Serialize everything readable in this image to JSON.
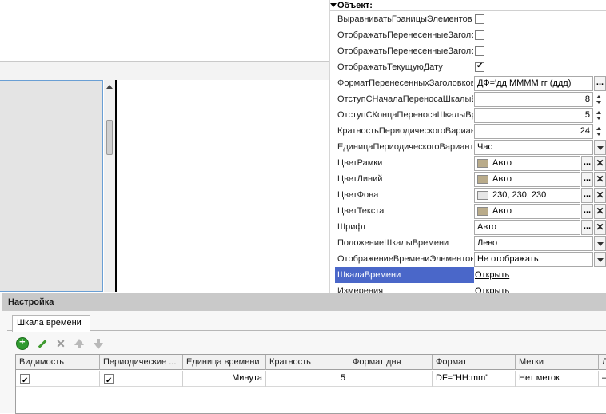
{
  "properties": {
    "section_title": "Объект:",
    "rows": [
      {
        "name": "ВыравниватьГраницыЭлементов",
        "type": "checkbox",
        "checked": false
      },
      {
        "name": "ОтображатьПеренесенныеЗаголовки",
        "type": "checkbox",
        "checked": false
      },
      {
        "name": "ОтображатьПеренесенныеЗаголовкиШкалы",
        "type": "checkbox",
        "checked": false
      },
      {
        "name": "ОтображатьТекущуюДату",
        "type": "checkbox",
        "checked": true
      },
      {
        "name": "ФорматПеренесенныхЗаголовков",
        "type": "text",
        "value": "ДФ='дд ММММ гг (ддд)'"
      },
      {
        "name": "ОтступСНачалаПереносаШкалыВремени",
        "type": "number",
        "value": "8"
      },
      {
        "name": "ОтступСКонцаПереносаШкалыВремени",
        "type": "number",
        "value": "5"
      },
      {
        "name": "КратностьПериодическогоВарианта",
        "type": "number",
        "value": "24"
      },
      {
        "name": "ЕдиницаПериодическогоВарианта",
        "type": "select",
        "value": "Час"
      },
      {
        "name": "ЦветРамки",
        "type": "color",
        "value": "Авто",
        "swatch": "#b9ab8a"
      },
      {
        "name": "ЦветЛиний",
        "type": "color",
        "value": "Авто",
        "swatch": "#b9ab8a"
      },
      {
        "name": "ЦветФона",
        "type": "color",
        "value": "230, 230, 230",
        "swatch": "#e6e6e6"
      },
      {
        "name": "ЦветТекста",
        "type": "color",
        "value": "Авто",
        "swatch": "#b9ab8a"
      },
      {
        "name": "Шрифт",
        "type": "font",
        "value": "Авто"
      },
      {
        "name": "ПоложениеШкалыВремени",
        "type": "select",
        "value": "Лево"
      },
      {
        "name": "ОтображениеВремениЭлементов",
        "type": "select",
        "value": "Не отображать"
      },
      {
        "name": "ШкалаВремени",
        "type": "link",
        "value": "Открыть",
        "selected": true
      },
      {
        "name": "Измерения",
        "type": "link",
        "value": "Открыть"
      }
    ]
  },
  "settings": {
    "title": "Настройка",
    "tab": "Шкала времени",
    "columns": [
      "Видимость",
      "Периодические ...",
      "Единица времени",
      "Кратность",
      "Формат дня",
      "Формат",
      "Метки",
      "Л"
    ],
    "rows": [
      {
        "visibility": true,
        "periodic": true,
        "unit": "Минута",
        "multiplicity": "5",
        "day_format": "",
        "format": "DF=\"HH:mm\"",
        "labels": "Нет меток",
        "last": "—"
      }
    ]
  },
  "toolbar": {
    "add_icon": "add-icon",
    "edit_icon": "edit-icon",
    "delete_icon": "delete-icon",
    "move_up_icon": "move-up-icon",
    "move_down_icon": "move-down-icon"
  }
}
